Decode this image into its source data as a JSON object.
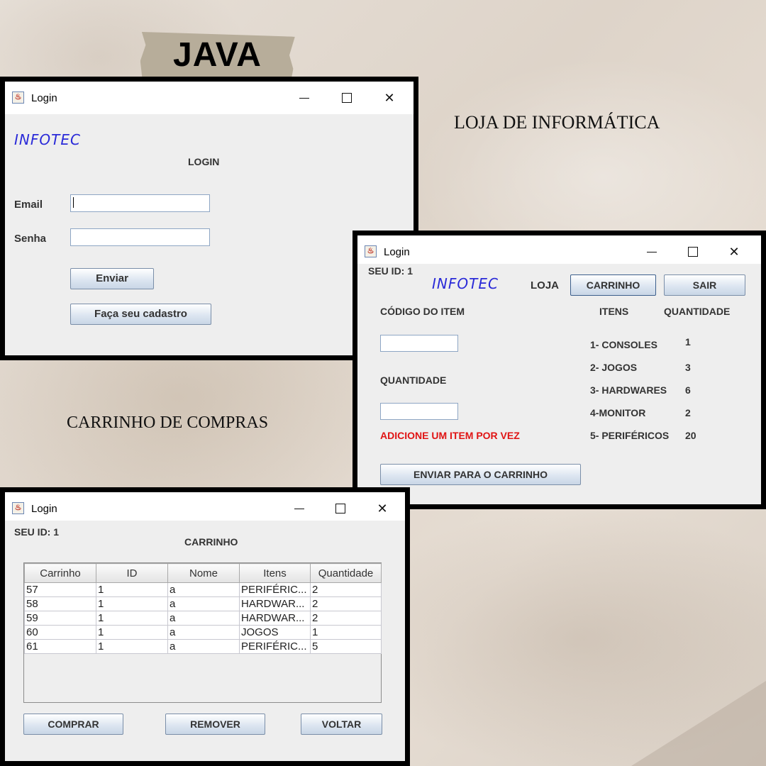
{
  "header": {
    "title": "JAVA"
  },
  "captions": {
    "store": "LOJA DE INFORMÁTICA",
    "cart": "CARRINHO DE COMPRAS"
  },
  "login_window": {
    "title": "Login",
    "brand": "INFOTEC",
    "heading": "LOGIN",
    "email_label": "Email",
    "email_value": "",
    "password_label": "Senha",
    "password_value": "",
    "submit_label": "Enviar",
    "register_label": "Faça seu cadastro"
  },
  "store_window": {
    "title": "Login",
    "user_id": "SEU ID: 1",
    "brand": "INFOTEC",
    "nav_store": "LOJA",
    "nav_cart": "CARRINHO",
    "nav_exit": "SAIR",
    "item_code_label": "CÓDIGO DO ITEM",
    "item_code_value": "",
    "quantity_label": "QUANTIDADE",
    "quantity_value": "",
    "warning": "ADICIONE UM ITEM POR VEZ",
    "send_label": "ENVIAR PARA O CARRINHO",
    "items_header": "ITENS",
    "qty_header": "QUANTIDADE",
    "items": [
      {
        "name": "1- CONSOLES",
        "qty": "1"
      },
      {
        "name": "2- JOGOS",
        "qty": "3"
      },
      {
        "name": "3- HARDWARES",
        "qty": "6"
      },
      {
        "name": "4-MONITOR",
        "qty": "2"
      },
      {
        "name": "5- PERIFÉRICOS",
        "qty": "20"
      }
    ]
  },
  "cart_window": {
    "title": "Login",
    "user_id": "SEU ID: 1",
    "heading": "CARRINHO",
    "columns": [
      "Carrinho",
      "ID",
      "Nome",
      "Itens",
      "Quantidade"
    ],
    "rows": [
      [
        "57",
        "1",
        "a",
        "PERIFÉRIC...",
        "2"
      ],
      [
        "58",
        "1",
        "a",
        "HARDWAR...",
        "2"
      ],
      [
        "59",
        "1",
        "a",
        "HARDWAR...",
        "2"
      ],
      [
        "60",
        "1",
        "a",
        "JOGOS",
        "1"
      ],
      [
        "61",
        "1",
        "a",
        "PERIFÉRIC...",
        "5"
      ]
    ],
    "buy_label": "COMPRAR",
    "remove_label": "REMOVER",
    "back_label": "VOLTAR"
  }
}
